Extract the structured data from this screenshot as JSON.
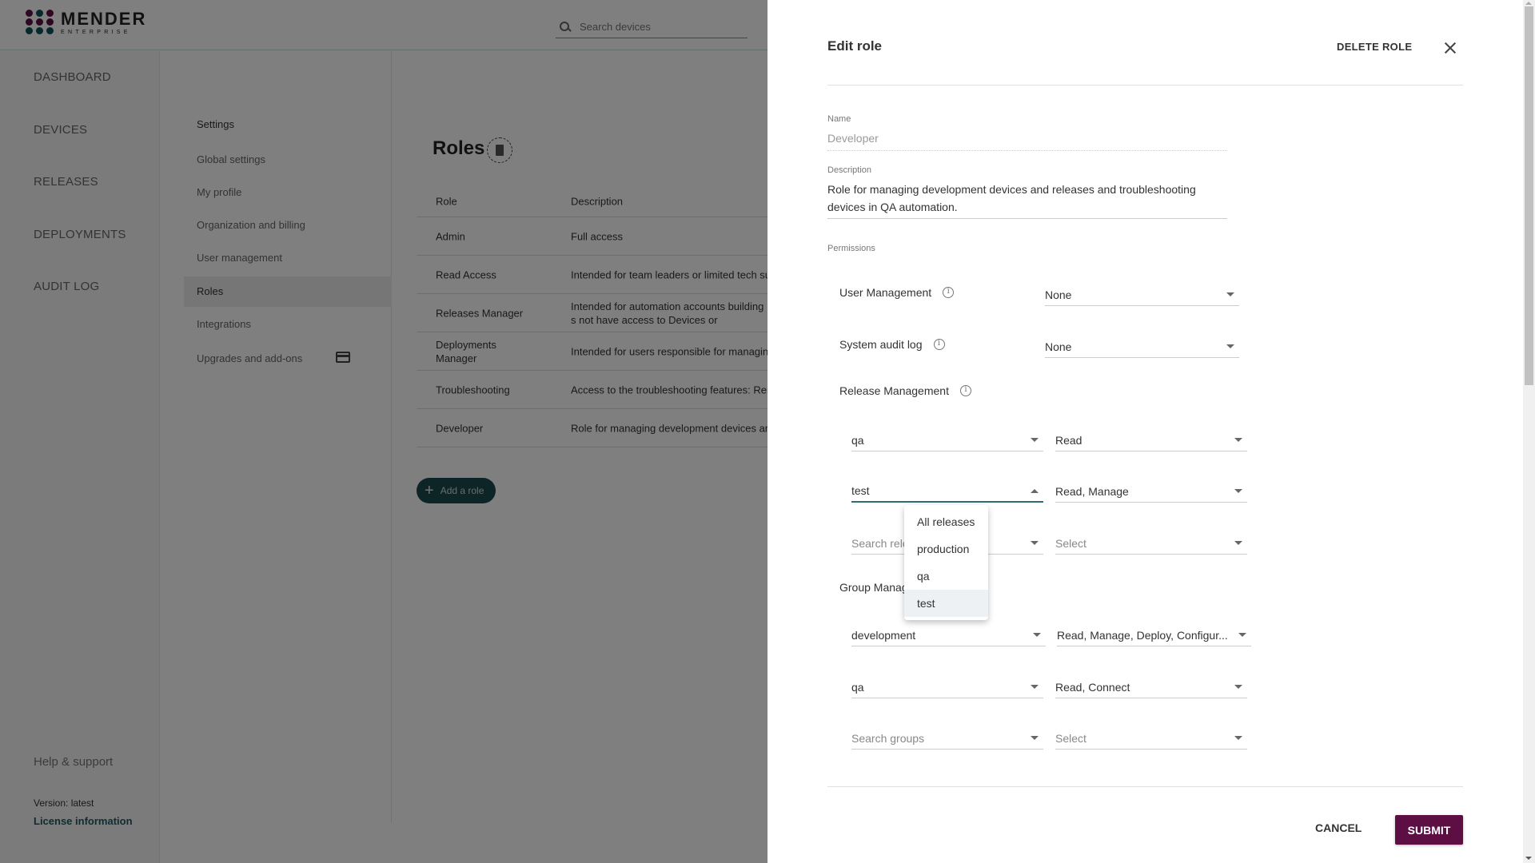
{
  "app": {
    "logo_title": "MENDER",
    "logo_subtitle": "ENTERPRISE",
    "search_placeholder": "Search devices",
    "brand_colors": {
      "primary": "#5d0f43",
      "accent": "#1a4a4f",
      "teal_dots": "#0f5257"
    }
  },
  "leftnav": {
    "items": [
      {
        "label": "DASHBOARD"
      },
      {
        "label": "DEVICES"
      },
      {
        "label": "RELEASES"
      },
      {
        "label": "DEPLOYMENTS"
      },
      {
        "label": "AUDIT LOG"
      }
    ],
    "help": "Help & support",
    "version": "Version: latest",
    "license": "License information"
  },
  "settings_nav": {
    "title": "Settings",
    "items": [
      {
        "label": "Global settings"
      },
      {
        "label": "My profile"
      },
      {
        "label": "Organization and billing"
      },
      {
        "label": "User management"
      },
      {
        "label": "Roles",
        "active": true
      },
      {
        "label": "Integrations"
      },
      {
        "label": "Upgrades and add-ons"
      }
    ]
  },
  "roles": {
    "title": "Roles",
    "columns": [
      "Role",
      "Description"
    ],
    "rows": [
      {
        "role": "Admin",
        "description": "Full access"
      },
      {
        "role": "Read Access",
        "description": "Intended for team leaders or limited tech su"
      },
      {
        "role": "Releases Manager",
        "description": "Intended for automation accounts building s not have access to Devices or Deployments."
      },
      {
        "role": "Deployments Manager",
        "description": "Intended for users responsible for managing"
      },
      {
        "role": "Troubleshooting",
        "description": "Access to the troubleshooting features: Rem"
      },
      {
        "role": "Developer",
        "description": "Role for managing development devices and"
      }
    ],
    "add_button": "Add a role"
  },
  "drawer": {
    "title": "Edit role",
    "delete_label": "DELETE ROLE",
    "name_label": "Name",
    "name_value": "Developer",
    "description_label": "Description",
    "description_value": "Role for managing development devices and releases and troubleshooting devices in QA automation.",
    "permissions_label": "Permissions",
    "user_management": {
      "label": "User Management",
      "value": "None"
    },
    "system_audit_log": {
      "label": "System audit log",
      "value": "None"
    },
    "release_management": {
      "label": "Release Management",
      "rows": [
        {
          "target": "qa",
          "permission": "Read"
        },
        {
          "target": "test",
          "permission": "Read, Manage",
          "open": true
        },
        {
          "target_placeholder": "Search releases",
          "permission_placeholder": "Select"
        }
      ],
      "dropdown_options": [
        {
          "label": "All releases"
        },
        {
          "label": "production"
        },
        {
          "label": "qa"
        },
        {
          "label": "test",
          "selected": true
        }
      ]
    },
    "group_management": {
      "label": "Group Management",
      "rows": [
        {
          "target": "development",
          "permission": "Read, Manage, Deploy, Configur..."
        },
        {
          "target": "qa",
          "permission": "Read, Connect"
        },
        {
          "target_placeholder": "Search groups",
          "permission_placeholder": "Select"
        }
      ]
    },
    "cancel_label": "CANCEL",
    "submit_label": "SUBMIT"
  }
}
